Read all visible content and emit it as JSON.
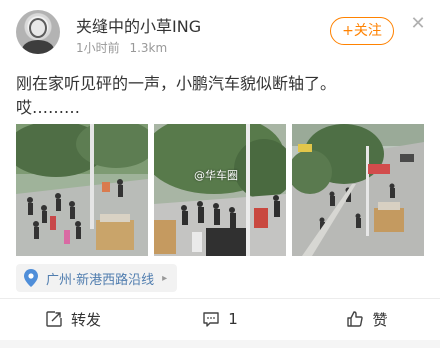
{
  "post": {
    "author": {
      "username": "夹缝中的小草ING",
      "time": "1小时前",
      "distance": "1.3km"
    },
    "follow_label": "+关注",
    "close_icon": "close-icon",
    "text_lines": [
      "刚在家听见砰的一声，小鹏汽车貌似断轴了。",
      "哎………"
    ],
    "images": {
      "count": 3,
      "watermark": "@华车圈"
    },
    "location": {
      "icon": "location-pin-icon",
      "text": "广州·新港西路沿线",
      "arrow": "▸"
    },
    "actions": {
      "repost_label": "转发",
      "comment_count": "1",
      "like_label": "赞"
    },
    "colors": {
      "accent": "#ff8200",
      "link": "#507daf",
      "text": "#333333",
      "secondary": "#999999"
    }
  }
}
